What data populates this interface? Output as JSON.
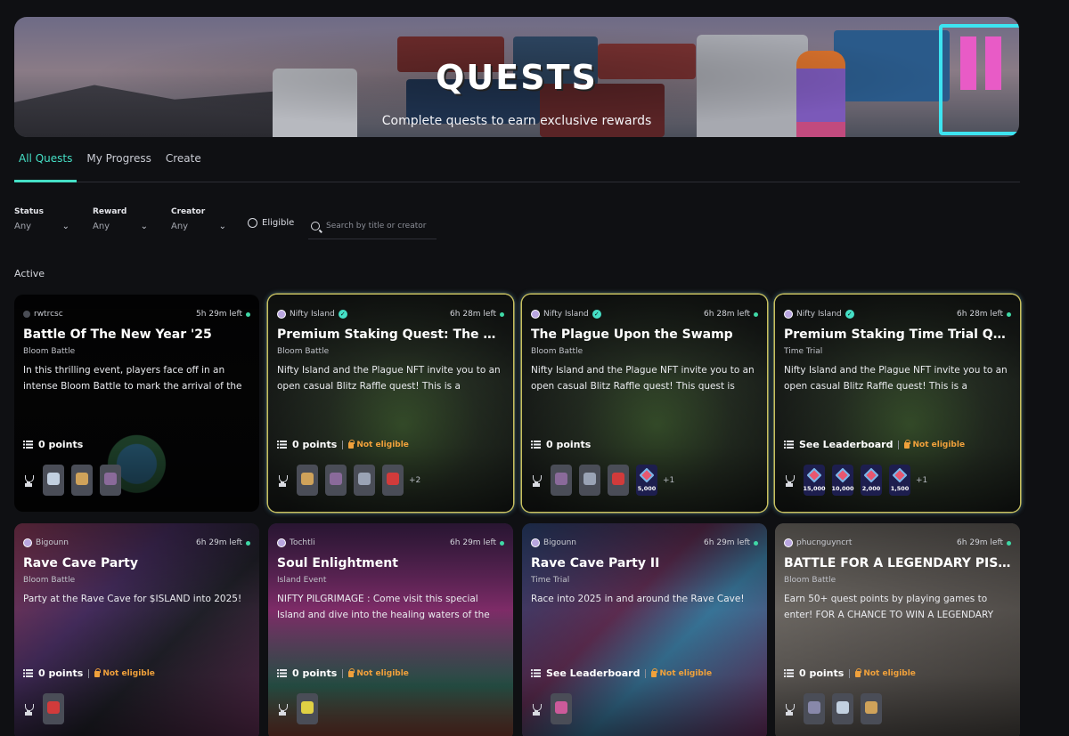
{
  "banner": {
    "title": "QUESTS",
    "subtitle": "Complete quests to earn exclusive rewards"
  },
  "tabs": [
    {
      "label": "All Quests",
      "active": true
    },
    {
      "label": "My Progress",
      "active": false
    },
    {
      "label": "Create",
      "active": false
    }
  ],
  "filters": {
    "status": {
      "label": "Status",
      "value": "Any"
    },
    "reward": {
      "label": "Reward",
      "value": "Any"
    },
    "creator": {
      "label": "Creator",
      "value": "Any"
    },
    "eligible_label": "Eligible",
    "search_placeholder": "Search by title or creator"
  },
  "section_label": "Active",
  "not_eligible_text": "Not eligible",
  "accent_color": "#45e0c6",
  "cards": [
    {
      "creator": "rwtrcsc",
      "verified": false,
      "time_left": "5h 29m left",
      "title": "Battle Of The New Year '25",
      "type": "Bloom Battle",
      "description": "In this thrilling event, players face off in an intense Bloom Battle to mark the arrival of the new year...",
      "points": "0 points",
      "not_eligible": false,
      "rewards": [
        "",
        "",
        ""
      ],
      "more": ""
    },
    {
      "creator": "Nifty Island",
      "verified": true,
      "time_left": "6h 28m left",
      "title": "Premium Staking Quest: The Plague Upo...",
      "type": "Bloom Battle",
      "description": "Nifty Island and the Plague NFT invite you to an open casual Blitz Raffle quest! This is a premium staking...",
      "points": "0 points",
      "not_eligible": true,
      "rewards": [
        "",
        "",
        "",
        ""
      ],
      "more": "+2"
    },
    {
      "creator": "Nifty Island",
      "verified": true,
      "time_left": "6h 28m left",
      "title": "The Plague Upon the Swamp",
      "type": "Bloom Battle",
      "description": "Nifty Island and the Plague NFT invite you to an open casual Blitz Raffle quest! This quest is open to all. Ear...",
      "points": "0 points",
      "not_eligible": false,
      "rewards": [
        "",
        "",
        "",
        "5,000"
      ],
      "more": "+1"
    },
    {
      "creator": "Nifty Island",
      "verified": true,
      "time_left": "6h 28m left",
      "title": "Premium Staking Time Trial Quest: The...",
      "type": "Time Trial",
      "description": "Nifty Island and the Plague NFT invite you to an open casual Blitz Raffle quest! This is a premium staking...",
      "points": "See Leaderboard",
      "not_eligible": true,
      "rewards": [
        "15,000",
        "10,000",
        "2,000",
        "1,500"
      ],
      "more": "+1"
    },
    {
      "creator": "Bigounn",
      "verified": false,
      "time_left": "6h 29m left",
      "title": "Rave Cave Party",
      "type": "Bloom Battle",
      "description": "Party at the Rave Cave for $ISLAND into 2025!",
      "points": "0 points",
      "not_eligible": true,
      "rewards": [
        ""
      ],
      "more": ""
    },
    {
      "creator": "Tochtli",
      "verified": false,
      "time_left": "6h 29m left",
      "title": "Soul Enlightment",
      "type": "Island Event",
      "description": "NIFTY PILGRIMAGE : Come visit this special Island and dive into the healing waters of the cenote. Enlighten...",
      "points": "0 points",
      "not_eligible": true,
      "rewards": [
        ""
      ],
      "more": ""
    },
    {
      "creator": "Bigounn",
      "verified": false,
      "time_left": "6h 29m left",
      "title": "Rave Cave Party II",
      "type": "Time Trial",
      "description": "Race into 2025 in and around the Rave Cave!",
      "points": "See Leaderboard",
      "not_eligible": true,
      "rewards": [
        ""
      ],
      "more": ""
    },
    {
      "creator": "phucnguyncrt",
      "verified": false,
      "time_left": "6h 29m left",
      "title": "BATTLE FOR A LEGENDARY PISTOL AND...",
      "type": "Bloom Battle",
      "description": "Earn 50+ quest points by playing games to enter! FOR A CHANCE TO WIN A LEGENDARY PISTOL AND COOL...",
      "points": "0 points",
      "not_eligible": true,
      "rewards": [
        "",
        "",
        ""
      ],
      "more": ""
    }
  ]
}
